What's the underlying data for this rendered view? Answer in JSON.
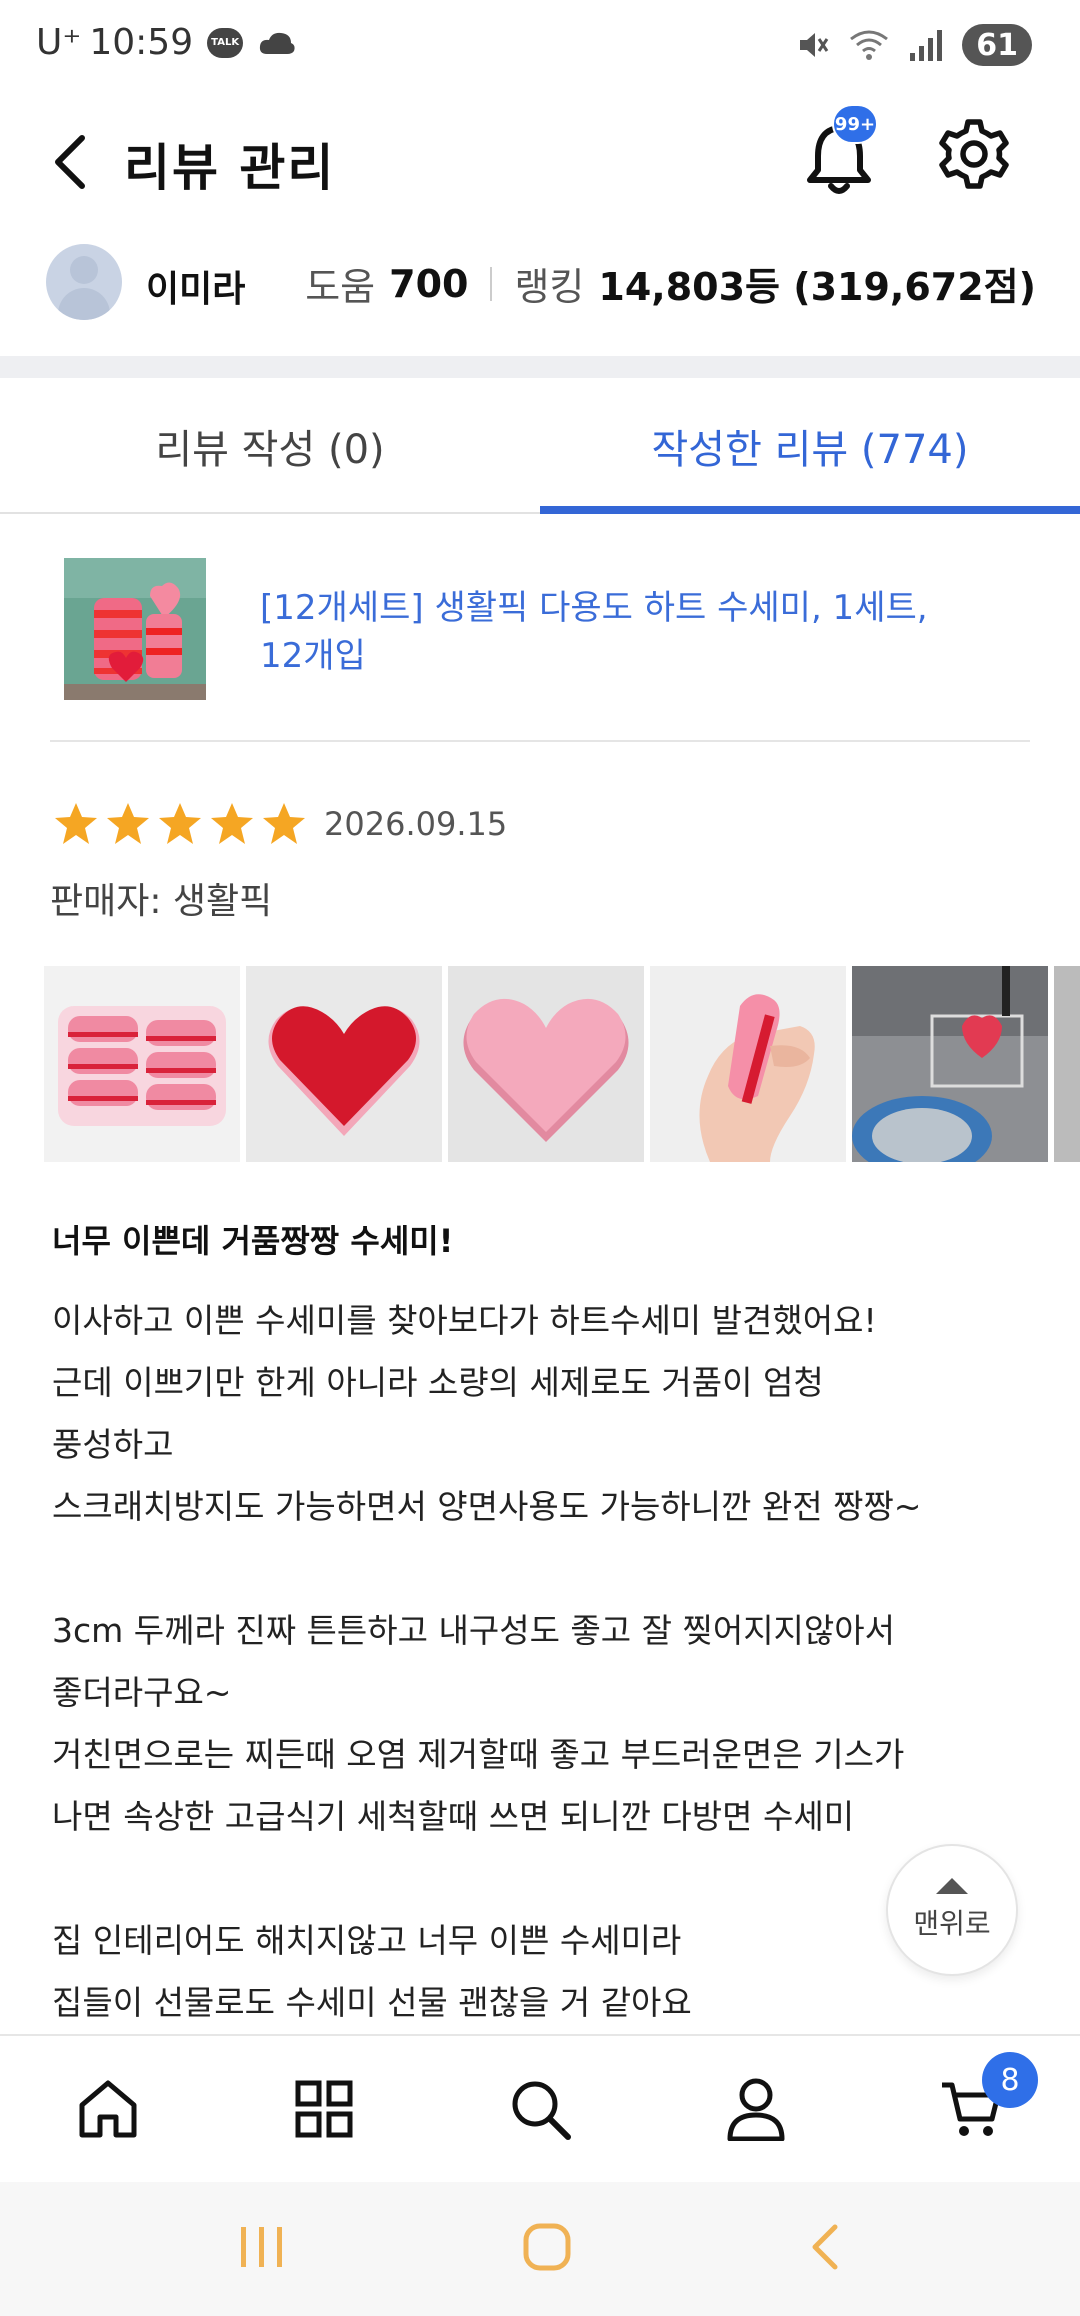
{
  "status_bar": {
    "carrier": "U⁺",
    "time": "10:59",
    "talk_icon": "TALK",
    "battery": "61"
  },
  "header": {
    "title": "리뷰 관리",
    "notification_badge": "99+"
  },
  "profile": {
    "name": "이미라",
    "help_label": "도움",
    "help_value": "700",
    "rank_label": "랭킹",
    "rank_value": "14,803등 (319,672점)"
  },
  "tabs": [
    {
      "label": "리뷰 작성 (0)"
    },
    {
      "label": "작성한 리뷰 (774)"
    }
  ],
  "product": {
    "name": "[12개세트] 생활픽 다용도 하트 수세미, 1세트, 12개입"
  },
  "review": {
    "rating": 5,
    "date": "2026.09.15",
    "seller": "판매자: 생활픽",
    "title": "너무 이쁜데 거품짱짱 수세미!",
    "body_lines": [
      "이사하고 이쁜 수세미를 찾아보다가 하트수세미 발견했어요!",
      "근데 이쁘기만 한게 아니라 소량의 세제로도 거품이 엄청",
      "풍성하고",
      "스크래치방지도 가능하면서 양면사용도 가능하니깐 완전 짱짱~",
      "",
      "3cm 두께라 진짜 튼튼하고 내구성도 좋고 잘 찢어지지않아서",
      "좋더라구요~",
      "거친면으로는 찌든때 오염 제거할때 좋고 부드러운면은 기스가",
      "나면 속상한 고급식기 세척할때 쓰면 되니깐 다방면 수세미",
      "",
      "집 인테리어도 해치지않고 너무 이쁜 수세미라",
      "집들이 선물로도 수세미 선물 괜찮을 거 같아요"
    ]
  },
  "to_top_label": "맨위로",
  "bottom_nav": {
    "cart_badge": "8"
  },
  "colors": {
    "accent": "#3366d6",
    "badge": "#2f6fe8",
    "star": "#f5a623",
    "sys_nav_icon": "#f0b254"
  }
}
